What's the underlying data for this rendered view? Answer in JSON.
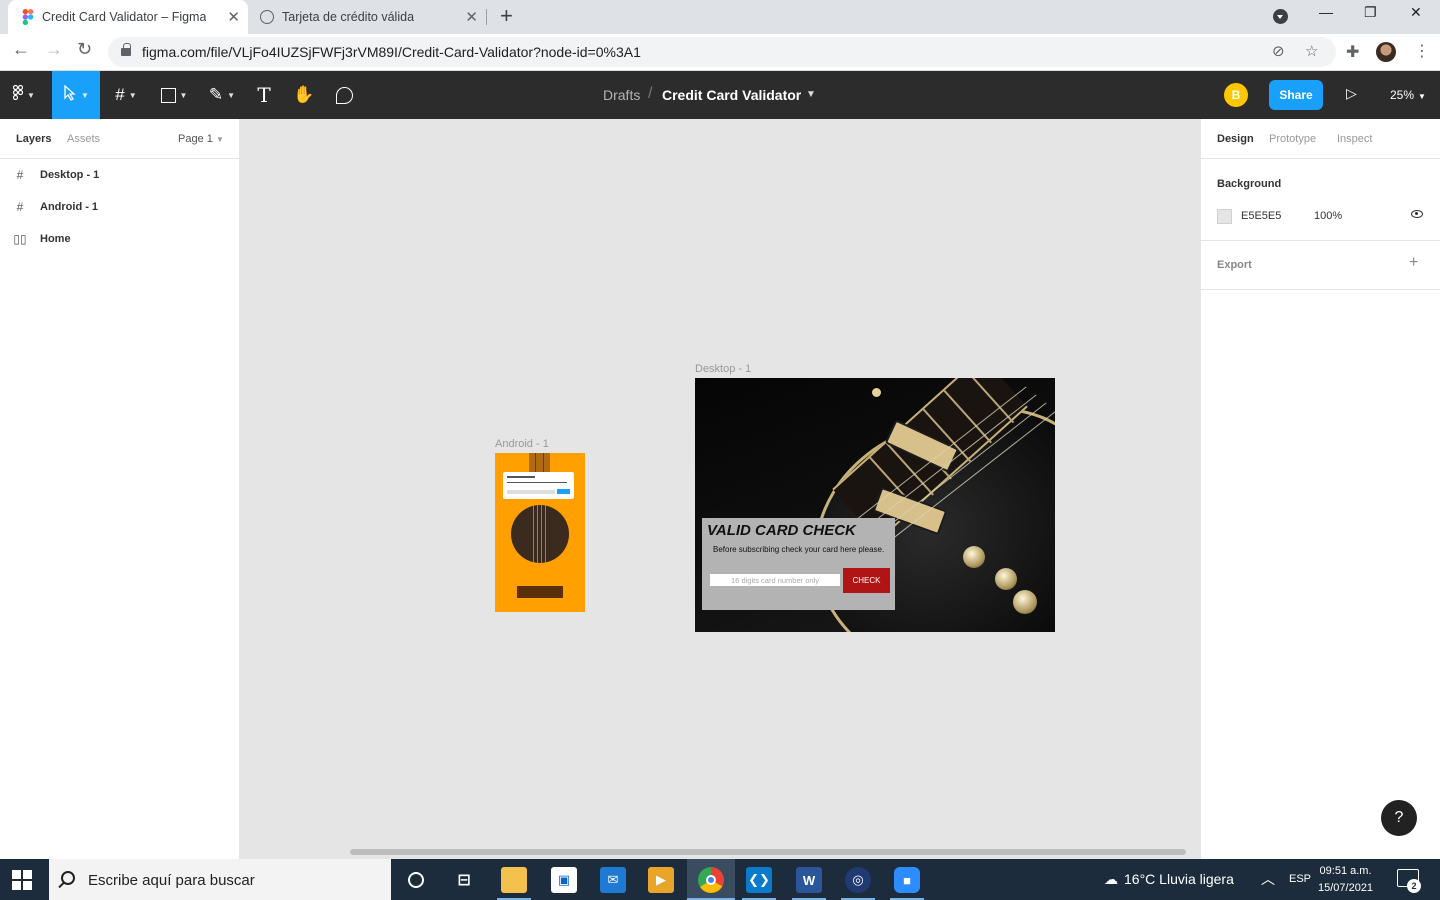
{
  "browser": {
    "tabs": [
      {
        "title": "Credit Card Validator – Figma",
        "icon": "figma-icon",
        "active": true
      },
      {
        "title": "Tarjeta de crédito válida",
        "icon": "globe-icon",
        "active": false
      }
    ],
    "url": "figma.com/file/VLjFo4IUZSjFWFj3rVM89I/Credit-Card-Validator?node-id=0%3A1"
  },
  "figma": {
    "toolbar": {
      "breadcrumb": "Drafts",
      "separator": "/",
      "file_title": "Credit Card Validator",
      "avatar_initial": "B",
      "share_label": "Share",
      "zoom": "25%"
    },
    "left_panel": {
      "tabs": [
        "Layers",
        "Assets"
      ],
      "page": "Page 1",
      "layers": [
        {
          "name": "Desktop - 1",
          "icon": "frame-icon"
        },
        {
          "name": "Android - 1",
          "icon": "frame-icon"
        },
        {
          "name": "Home",
          "icon": "component-set-icon"
        }
      ]
    },
    "canvas": {
      "android_label": "Android - 1",
      "desktop_label": "Desktop - 1",
      "card": {
        "title": "VALID CARD CHECK",
        "subtitle": "Before subscribing check your card here please.",
        "input_placeholder": "16 digits card number only",
        "button": "CHECK"
      },
      "help": "?"
    },
    "right_panel": {
      "tabs": [
        "Design",
        "Prototype",
        "Inspect"
      ],
      "background_label": "Background",
      "bg_hex": "E5E5E5",
      "bg_opacity": "100%",
      "export_label": "Export",
      "export_add": "+"
    }
  },
  "taskbar": {
    "search_placeholder": "Escribe aquí para buscar",
    "weather": "16°C  Lluvia ligera",
    "language": "ESP",
    "time": "09:51 a.m.",
    "date": "15/07/2021",
    "notifications": "2"
  },
  "colors": {
    "figma_accent": "#18a0fb",
    "canvas_bg": "#e5e5e5",
    "android_bg": "#ff9f00",
    "check_button": "#b01414"
  }
}
